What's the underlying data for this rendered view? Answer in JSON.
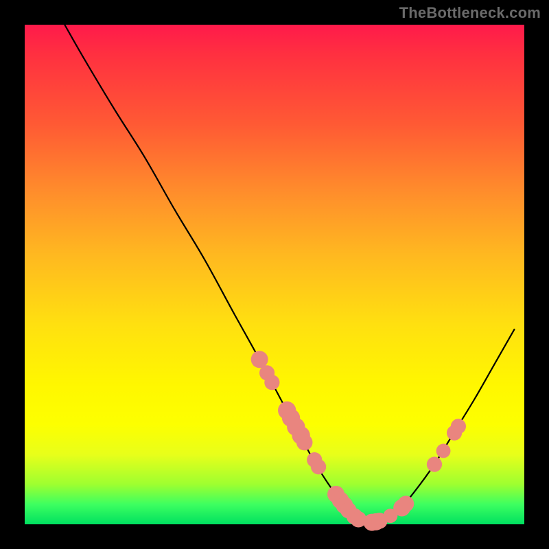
{
  "watermark": "TheBottleneck.com",
  "colors": {
    "marker": "#e9857f",
    "curve": "#000000"
  },
  "chart_data": {
    "type": "line",
    "title": "",
    "xlabel": "",
    "ylabel": "",
    "xlim": [
      0,
      100
    ],
    "ylim": [
      0,
      100
    ],
    "note": "Axes are not labeled in the source image; values are normalized to 0–100. y represents bottleneck percentage (0 = no bottleneck, at the bottom green band; 100 at the top red band).",
    "series": [
      {
        "name": "bottleneck-curve",
        "x": [
          8,
          12,
          18,
          24,
          30,
          36,
          42,
          47,
          51,
          55,
          58,
          60.5,
          63,
          65,
          67,
          69,
          71,
          73,
          75,
          78,
          82,
          86,
          90,
          94,
          98
        ],
        "y": [
          100,
          93,
          83,
          73.5,
          63,
          53,
          42,
          33,
          25.5,
          18,
          12.5,
          8.5,
          5,
          2.5,
          1,
          0.3,
          0.6,
          1.5,
          3,
          6.5,
          12,
          18.5,
          25,
          32,
          39
        ]
      }
    ],
    "markers": [
      {
        "x": 47.0,
        "y": 33.0,
        "r": 1.3
      },
      {
        "x": 48.5,
        "y": 30.3,
        "r": 1.1
      },
      {
        "x": 49.5,
        "y": 28.4,
        "r": 1.1
      },
      {
        "x": 52.5,
        "y": 22.8,
        "r": 1.4
      },
      {
        "x": 53.3,
        "y": 21.3,
        "r": 1.4
      },
      {
        "x": 54.3,
        "y": 19.5,
        "r": 1.4
      },
      {
        "x": 55.3,
        "y": 17.8,
        "r": 1.4
      },
      {
        "x": 56.0,
        "y": 16.4,
        "r": 1.2
      },
      {
        "x": 58.0,
        "y": 12.9,
        "r": 1.1
      },
      {
        "x": 58.8,
        "y": 11.5,
        "r": 1.1
      },
      {
        "x": 62.3,
        "y": 6.0,
        "r": 1.3
      },
      {
        "x": 63.2,
        "y": 4.8,
        "r": 1.3
      },
      {
        "x": 64.0,
        "y": 3.8,
        "r": 1.3
      },
      {
        "x": 64.8,
        "y": 2.8,
        "r": 1.2
      },
      {
        "x": 66.0,
        "y": 1.6,
        "r": 1.2
      },
      {
        "x": 66.8,
        "y": 1.0,
        "r": 1.2
      },
      {
        "x": 69.5,
        "y": 0.4,
        "r": 1.3
      },
      {
        "x": 70.3,
        "y": 0.5,
        "r": 1.3
      },
      {
        "x": 71.0,
        "y": 0.7,
        "r": 1.2
      },
      {
        "x": 73.2,
        "y": 1.7,
        "r": 1.0
      },
      {
        "x": 75.5,
        "y": 3.3,
        "r": 1.3
      },
      {
        "x": 76.3,
        "y": 4.1,
        "r": 1.2
      },
      {
        "x": 82.0,
        "y": 12.0,
        "r": 1.1
      },
      {
        "x": 83.8,
        "y": 14.7,
        "r": 1.0
      },
      {
        "x": 86.0,
        "y": 18.3,
        "r": 1.1
      },
      {
        "x": 86.8,
        "y": 19.6,
        "r": 1.1
      }
    ]
  }
}
